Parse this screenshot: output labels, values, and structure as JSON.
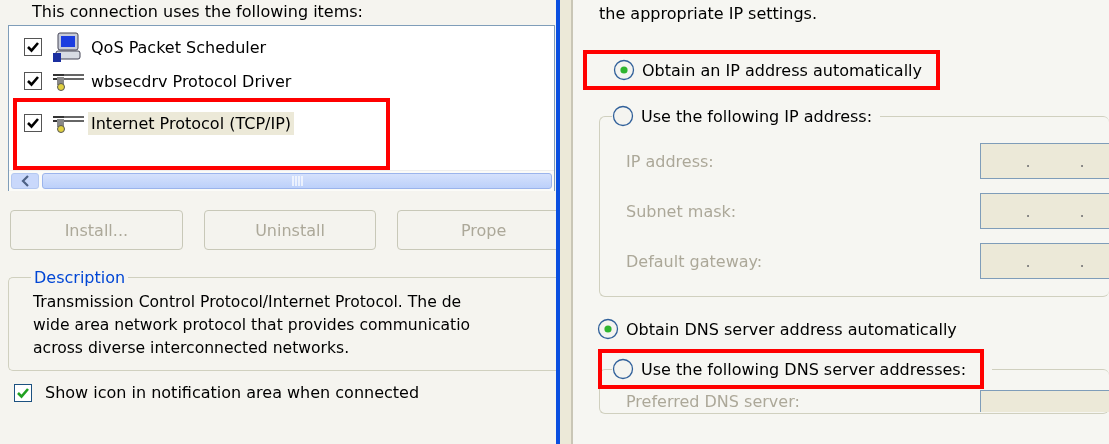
{
  "items_panel": {
    "heading": "This connection uses the following items:",
    "items": [
      {
        "label": "QoS Packet Scheduler",
        "kind": "service",
        "checked": true,
        "selected": false,
        "annotated": false
      },
      {
        "label": "wbsecdrv Protocol Driver",
        "kind": "protocol",
        "checked": true,
        "selected": false,
        "annotated": false
      },
      {
        "label": "Internet Protocol (TCP/IP)",
        "kind": "protocol",
        "checked": true,
        "selected": true,
        "annotated": true
      }
    ],
    "buttons": [
      {
        "label": "Install...",
        "disabled": true
      },
      {
        "label": "Uninstall",
        "disabled": true
      },
      {
        "label": "Prope",
        "disabled": true
      }
    ],
    "description": {
      "title": "Description",
      "lines": [
        "Transmission Control Protocol/Internet Protocol. The de",
        "wide area network protocol that provides communicatio",
        "across diverse interconnected networks."
      ]
    },
    "notify_checkbox": {
      "label": "Show icon in notification area when connected",
      "checked": true
    }
  },
  "ip_panel": {
    "intro": "the appropriate IP settings.",
    "ip_options": [
      {
        "label": "Obtain an IP address automatically",
        "selected": true,
        "annotated": true
      },
      {
        "label": "Use the following IP address:",
        "selected": false,
        "annotated": false
      }
    ],
    "ip_fields": [
      {
        "label": "IP address:",
        "disabled": true,
        "separators": [
          ".",
          "."
        ]
      },
      {
        "label": "Subnet mask:",
        "disabled": true,
        "separators": [
          ".",
          "."
        ]
      },
      {
        "label": "Default gateway:",
        "disabled": true,
        "separators": [
          ".",
          "."
        ]
      }
    ],
    "dns_options": [
      {
        "label": "Obtain DNS server address automatically",
        "selected": true,
        "annotated": false
      },
      {
        "label": "Use the following DNS server addresses:",
        "selected": false,
        "annotated": true
      }
    ],
    "dns_fields": [
      {
        "label": "Preferred DNS server:",
        "disabled": true
      }
    ]
  }
}
